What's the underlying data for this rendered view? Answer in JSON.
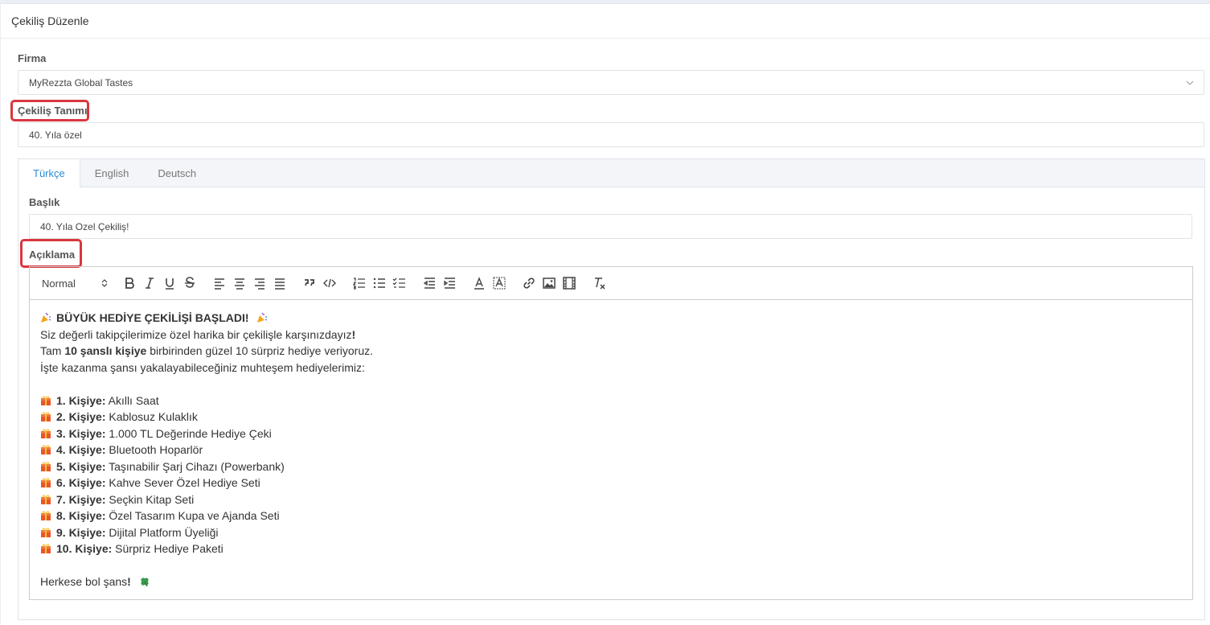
{
  "page": {
    "title": "Çekiliş Düzenle"
  },
  "form": {
    "firma_label": "Firma",
    "firma_value": "MyRezzta Global Tastes",
    "tanim_label": "Çekiliş Tanımı",
    "tanim_value": "40. Yıla özel"
  },
  "tabs": [
    {
      "label": "Türkçe",
      "active": true
    },
    {
      "label": "English",
      "active": false
    },
    {
      "label": "Deutsch",
      "active": false
    }
  ],
  "tab_content": {
    "baslik_label": "Başlık",
    "baslik_value": "40. Yıla Ozel Çekiliş!",
    "aciklama_label": "Açıklama"
  },
  "editor": {
    "header_select": "Normal",
    "toolbar_icons": [
      "bold-icon",
      "italic-icon",
      "underline-icon",
      "strike-icon",
      "align-left-icon",
      "align-center-icon",
      "align-right-icon",
      "align-justify-icon",
      "blockquote-icon",
      "code-block-icon",
      "ordered-list-icon",
      "bullet-list-icon",
      "check-list-icon",
      "outdent-icon",
      "indent-icon",
      "font-color-icon",
      "background-color-icon",
      "link-icon",
      "image-icon",
      "video-icon",
      "clean-format-icon"
    ],
    "content": {
      "heading": "BÜYÜK HEDİYE ÇEKİLİŞİ BAŞLADI!",
      "line1": "Siz değerli takipçilerimize özel harika bir çekilişle karşınızdayız",
      "line1_end": "!",
      "line2_pre": "Tam ",
      "line2_bold": "10 şanslı kişiye",
      "line2_post": " birbirinden güzel 10 sürpriz hediye veriyoruz.",
      "line3": "İşte kazanma şansı yakalayabileceğiniz muhteşem hediyelerimiz:",
      "prizes": [
        {
          "rank": "1. Kişiye:",
          "prize": " Akıllı Saat"
        },
        {
          "rank": "2. Kişiye:",
          "prize": " Kablosuz Kulaklık"
        },
        {
          "rank": "3. Kişiye:",
          "prize": " 1.000 TL Değerinde Hediye Çeki"
        },
        {
          "rank": "4. Kişiye:",
          "prize": " Bluetooth Hoparlör"
        },
        {
          "rank": "5. Kişiye:",
          "prize": " Taşınabilir Şarj Cihazı (Powerbank)"
        },
        {
          "rank": "6. Kişiye:",
          "prize": " Kahve Sever Özel Hediye Seti"
        },
        {
          "rank": "7. Kişiye:",
          "prize": " Seçkin Kitap Seti"
        },
        {
          "rank": "8. Kişiye:",
          "prize": " Özel Tasarım Kupa ve Ajanda Seti"
        },
        {
          "rank": "9. Kişiye:",
          "prize": " Dijital Platform Üyeliği"
        },
        {
          "rank": "10. Kişiye:",
          "prize": " Sürpriz Hediye Paketi"
        }
      ],
      "closing": "Herkese bol şans",
      "closing_end": "!"
    }
  },
  "colors": {
    "accent": "#2a8bd5",
    "highlight": "#d9363e"
  }
}
